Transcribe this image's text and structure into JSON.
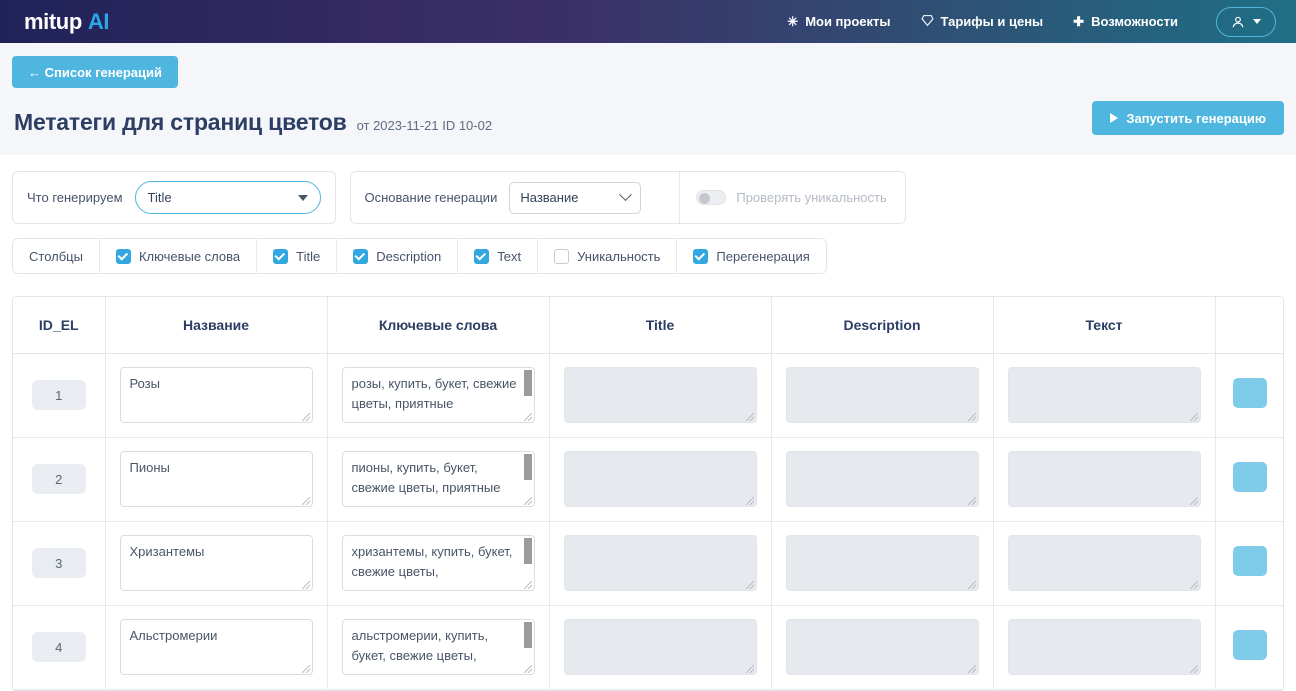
{
  "header": {
    "logo_main": "mitup",
    "logo_accent": "AI",
    "nav": [
      {
        "icon": "asterisk-icon",
        "glyph": "✳",
        "label": "Мои проекты"
      },
      {
        "icon": "diamond-icon",
        "glyph": "♛",
        "label": "Тарифы и цены"
      },
      {
        "icon": "plus-icon",
        "glyph": "✚",
        "label": "Возможности"
      }
    ],
    "user_menu": "user-account-menu"
  },
  "toolbar": {
    "back_label": "← Список генераций",
    "run_label": "Запустить генерацию"
  },
  "page": {
    "title": "Метатеги для страниц цветов",
    "date_prefix": "от",
    "date": "2023-11-21",
    "id_label": "ID 10-02",
    "subtitle": "от 2023-11-21  ID 10-02"
  },
  "controls": {
    "what_label": "Что генерируем",
    "what_value": "Title",
    "basis_label": "Основание генерации",
    "basis_value": "Название",
    "unique_toggle_label": "Проверять уникальность",
    "unique_toggle_on": false
  },
  "columns_bar": {
    "title": "Столбцы",
    "items": [
      {
        "label": "Ключевые слова",
        "checked": true
      },
      {
        "label": "Title",
        "checked": true
      },
      {
        "label": "Description",
        "checked": true
      },
      {
        "label": "Text",
        "checked": true
      },
      {
        "label": "Уникальность",
        "checked": false
      },
      {
        "label": "Перегенерация",
        "checked": true
      }
    ]
  },
  "table": {
    "headers": [
      "ID_EL",
      "Название",
      "Ключевые слова",
      "Title",
      "Description",
      "Текст",
      ""
    ],
    "rows": [
      {
        "id": "1",
        "name": "Розы",
        "keywords": "розы, купить, букет, свежие цветы, приятные",
        "title": "",
        "description": "",
        "text": ""
      },
      {
        "id": "2",
        "name": "Пионы",
        "keywords": "пионы, купить, букет, свежие цветы, приятные",
        "title": "",
        "description": "",
        "text": ""
      },
      {
        "id": "3",
        "name": "Хризантемы",
        "keywords": "хризантемы, купить, букет, свежие цветы,",
        "title": "",
        "description": "",
        "text": ""
      },
      {
        "id": "4",
        "name": "Альстромерии",
        "keywords": "альстромерии, купить, букет, свежие цветы,",
        "title": "",
        "description": "",
        "text": ""
      }
    ]
  },
  "colors": {
    "accent_blue": "#4fb6e0",
    "checkbox_blue": "#33a8e0",
    "action_button": "#7ecbea",
    "title_navy": "#2c3e63",
    "page_bg": "#f4f6fa"
  }
}
